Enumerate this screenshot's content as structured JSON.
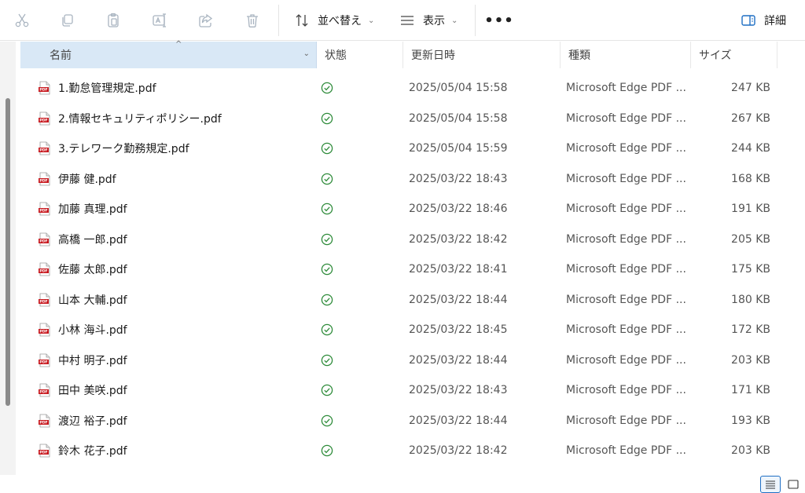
{
  "toolbar": {
    "sort_label": "並べ替え",
    "view_label": "表示",
    "more_label": "•••",
    "details_label": "詳細",
    "icons": [
      "cut-icon",
      "copy-icon",
      "paste-icon",
      "rename-icon",
      "share-icon",
      "delete-icon",
      "sort-icon",
      "view-icon",
      "details-pane-icon"
    ]
  },
  "header": {
    "name": "名前",
    "status": "状態",
    "date": "更新日時",
    "type": "種類",
    "size": "サイズ",
    "sort_indicator": "^"
  },
  "files": [
    {
      "name": "1.勤怠管理規定.pdf",
      "date": "2025/05/04 15:58",
      "type": "Microsoft Edge PDF ...",
      "size": "247 KB"
    },
    {
      "name": "2.情報セキュリティポリシー.pdf",
      "date": "2025/05/04 15:58",
      "type": "Microsoft Edge PDF ...",
      "size": "267 KB"
    },
    {
      "name": "3.テレワーク勤務規定.pdf",
      "date": "2025/05/04 15:59",
      "type": "Microsoft Edge PDF ...",
      "size": "244 KB"
    },
    {
      "name": "伊藤 健.pdf",
      "date": "2025/03/22 18:43",
      "type": "Microsoft Edge PDF ...",
      "size": "168 KB"
    },
    {
      "name": "加藤 真理.pdf",
      "date": "2025/03/22 18:46",
      "type": "Microsoft Edge PDF ...",
      "size": "191 KB"
    },
    {
      "name": "高橋 一郎.pdf",
      "date": "2025/03/22 18:42",
      "type": "Microsoft Edge PDF ...",
      "size": "205 KB"
    },
    {
      "name": "佐藤 太郎.pdf",
      "date": "2025/03/22 18:41",
      "type": "Microsoft Edge PDF ...",
      "size": "175 KB"
    },
    {
      "name": "山本 大輔.pdf",
      "date": "2025/03/22 18:44",
      "type": "Microsoft Edge PDF ...",
      "size": "180 KB"
    },
    {
      "name": "小林 海斗.pdf",
      "date": "2025/03/22 18:45",
      "type": "Microsoft Edge PDF ...",
      "size": "172 KB"
    },
    {
      "name": "中村 明子.pdf",
      "date": "2025/03/22 18:44",
      "type": "Microsoft Edge PDF ...",
      "size": "203 KB"
    },
    {
      "name": "田中 美咲.pdf",
      "date": "2025/03/22 18:43",
      "type": "Microsoft Edge PDF ...",
      "size": "171 KB"
    },
    {
      "name": "渡辺 裕子.pdf",
      "date": "2025/03/22 18:44",
      "type": "Microsoft Edge PDF ...",
      "size": "193 KB"
    },
    {
      "name": "鈴木 花子.pdf",
      "date": "2025/03/22 18:42",
      "type": "Microsoft Edge PDF ...",
      "size": "203 KB"
    }
  ],
  "colors": {
    "accent": "#1f6fc4",
    "header_selected": "#d9e8f6",
    "status_ok": "#2e8b3a",
    "pdf_red": "#c8191f",
    "disabled_icon": "#a9b4c0"
  }
}
